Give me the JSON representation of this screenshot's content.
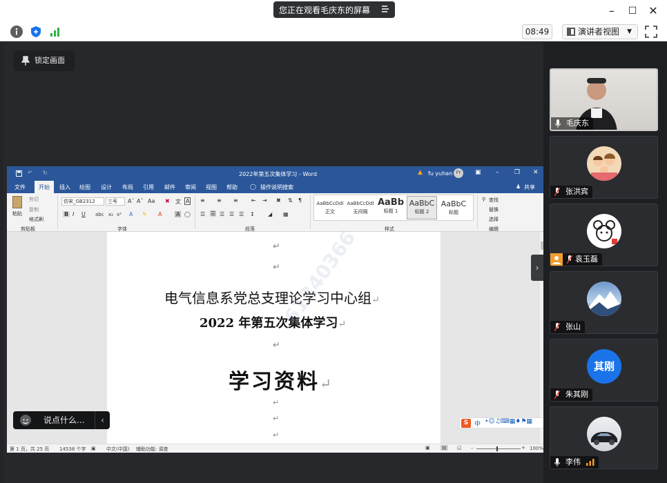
{
  "topbar": {
    "sharing_label": "您正在观看毛庆东的屏幕",
    "time": "08:49",
    "view_label": "演讲者视图"
  },
  "stage": {
    "lock_label": "锁定画面",
    "chat_placeholder": "说点什么..."
  },
  "word": {
    "window_title": "2022年第五次集体学习 - Word",
    "user_name": "fu yuhan",
    "user_initials": "FY",
    "share_label": "共享",
    "tabs": [
      "文件",
      "开始",
      "插入",
      "绘图",
      "设计",
      "布局",
      "引用",
      "邮件",
      "审阅",
      "视图",
      "帮助"
    ],
    "search_hint": "操作说明搜索",
    "ribbon": {
      "paste": "粘贴",
      "cut": "剪切",
      "copy": "复制",
      "format_painter": "格式刷",
      "clipboard_group": "剪贴板",
      "font_name": "仿宋_GB2312",
      "font_size": "三号",
      "font_group": "字体",
      "paragraph_group": "段落",
      "styles_group": "样式",
      "editing_group": "编辑",
      "find": "查找",
      "replace": "替换",
      "select": "选择",
      "styles": [
        {
          "preview": "AaBbCcDdI",
          "name": "正文"
        },
        {
          "preview": "AaBbCcDdI",
          "name": "无间隔"
        },
        {
          "preview": "AaBb",
          "name": "标题 1"
        },
        {
          "preview": "AaBbC",
          "name": "标题 2"
        },
        {
          "preview": "AaBbC",
          "name": "标题"
        }
      ]
    },
    "doc": {
      "line1": "电气信息系党总支理论学习中心组",
      "line2": "2022 年第五次集体学习",
      "line3": "学习资料",
      "watermark": "61340366"
    },
    "ime_label": "中",
    "status": {
      "page_info": "第 1 页，共 25 页",
      "word_count": "14538 个字",
      "language": "中文(中国)",
      "accessibility": "辅助功能: 调查",
      "zoom": "100%"
    }
  },
  "participants": [
    {
      "name": "毛庆东",
      "avatar_text": "",
      "avatar_color": "#d9d7d2",
      "muted": false
    },
    {
      "name": "张洪宾",
      "avatar_text": "",
      "avatar_color": "#f2d9b8",
      "muted": true
    },
    {
      "name": "袁玉磊",
      "avatar_text": "",
      "avatar_color": "#ffffff",
      "muted": true
    },
    {
      "name": "张山",
      "avatar_text": "",
      "avatar_color": "#9cc0e0",
      "muted": true
    },
    {
      "name": "朱其刚",
      "avatar_text": "其刚",
      "avatar_color": "#1a73e8",
      "muted": true
    },
    {
      "name": "李伟",
      "avatar_text": "",
      "avatar_color": "#cfd4da",
      "muted": false
    }
  ],
  "colors": {
    "word_blue": "#2b579a",
    "mute_red": "#e53935",
    "signal_green": "#2fb344",
    "brand_blue": "#1a73e8"
  }
}
